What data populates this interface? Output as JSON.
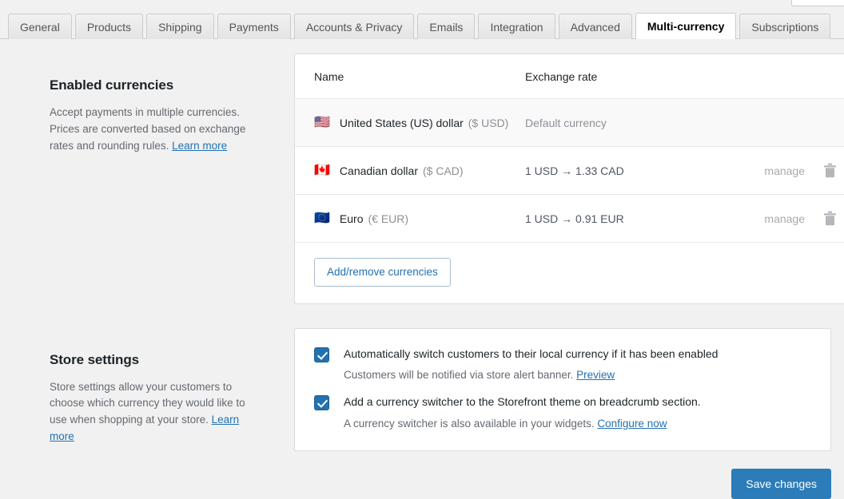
{
  "tabs": [
    {
      "label": "General",
      "active": false
    },
    {
      "label": "Products",
      "active": false
    },
    {
      "label": "Shipping",
      "active": false
    },
    {
      "label": "Payments",
      "active": false
    },
    {
      "label": "Accounts & Privacy",
      "active": false
    },
    {
      "label": "Emails",
      "active": false
    },
    {
      "label": "Integration",
      "active": false
    },
    {
      "label": "Advanced",
      "active": false
    },
    {
      "label": "Multi-currency",
      "active": true
    },
    {
      "label": "Subscriptions",
      "active": false
    }
  ],
  "enabled_currencies": {
    "heading": "Enabled currencies",
    "description": "Accept payments in multiple currencies. Prices are converted based on exchange rates and rounding rules.",
    "learn_more": "Learn more",
    "columns": {
      "name": "Name",
      "exchange_rate": "Exchange rate"
    },
    "rows": [
      {
        "flag": "flag-us-icon",
        "flag_glyph": "🇺🇸",
        "name": "United States (US) dollar",
        "code": "($ USD)",
        "rate": "Default currency",
        "is_default": true,
        "manage": "",
        "deletable": false
      },
      {
        "flag": "flag-ca-icon",
        "flag_glyph": "🇨🇦",
        "name": "Canadian dollar",
        "code": "($ CAD)",
        "rate": "1 USD → 1.33 CAD",
        "is_default": false,
        "manage": "manage",
        "deletable": true
      },
      {
        "flag": "flag-eu-icon",
        "flag_glyph": "🇪🇺",
        "name": "Euro",
        "code": "(€ EUR)",
        "rate": "1 USD → 0.91 EUR",
        "is_default": false,
        "manage": "manage",
        "deletable": true
      }
    ],
    "add_remove_button": "Add/remove currencies"
  },
  "store_settings": {
    "heading": "Store settings",
    "description": "Store settings allow your customers to choose which currency they would like to use when shopping at your store.",
    "learn_more": "Learn more",
    "options": [
      {
        "checked": true,
        "label": "Automatically switch customers to their local currency if it has been enabled",
        "sub_text": "Customers will be notified via store alert banner.",
        "sub_link": "Preview"
      },
      {
        "checked": true,
        "label": "Add a currency switcher to the Storefront theme on breadcrumb section.",
        "sub_text": "A currency switcher is also available in your widgets.",
        "sub_link": "Configure now"
      }
    ]
  },
  "footer": {
    "save_label": "Save changes"
  },
  "colors": {
    "accent_blue": "#2271b1",
    "save_button": "#2b7cb9",
    "page_background": "#f1f1f1",
    "muted_text": "#8c8f94"
  }
}
